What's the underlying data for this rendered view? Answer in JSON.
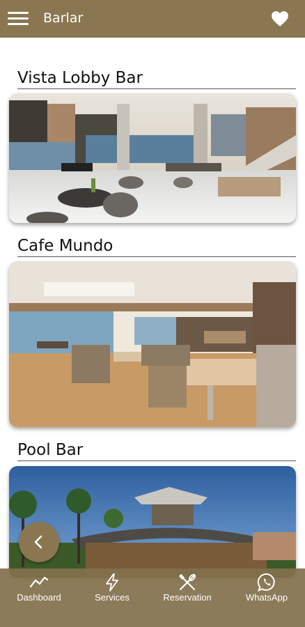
{
  "header": {
    "title": "Barlar",
    "colors": {
      "bar": "#8a7751",
      "text": "#ffffff"
    }
  },
  "sections": [
    {
      "title": "Vista Lobby Bar",
      "image": "lobby bar interior"
    },
    {
      "title": "Cafe Mundo",
      "image": "cafe interior"
    },
    {
      "title": "Pool Bar",
      "image": "pool bar exterior"
    }
  ],
  "nav": {
    "items": [
      {
        "label": "Dashboard",
        "icon": "trend-line-icon"
      },
      {
        "label": "Services",
        "icon": "lightning-icon"
      },
      {
        "label": "Reservation",
        "icon": "fork-knife-icon"
      },
      {
        "label": "WhatsApp",
        "icon": "whatsapp-icon"
      }
    ]
  },
  "back_button": {
    "icon": "chevron-left-icon"
  }
}
